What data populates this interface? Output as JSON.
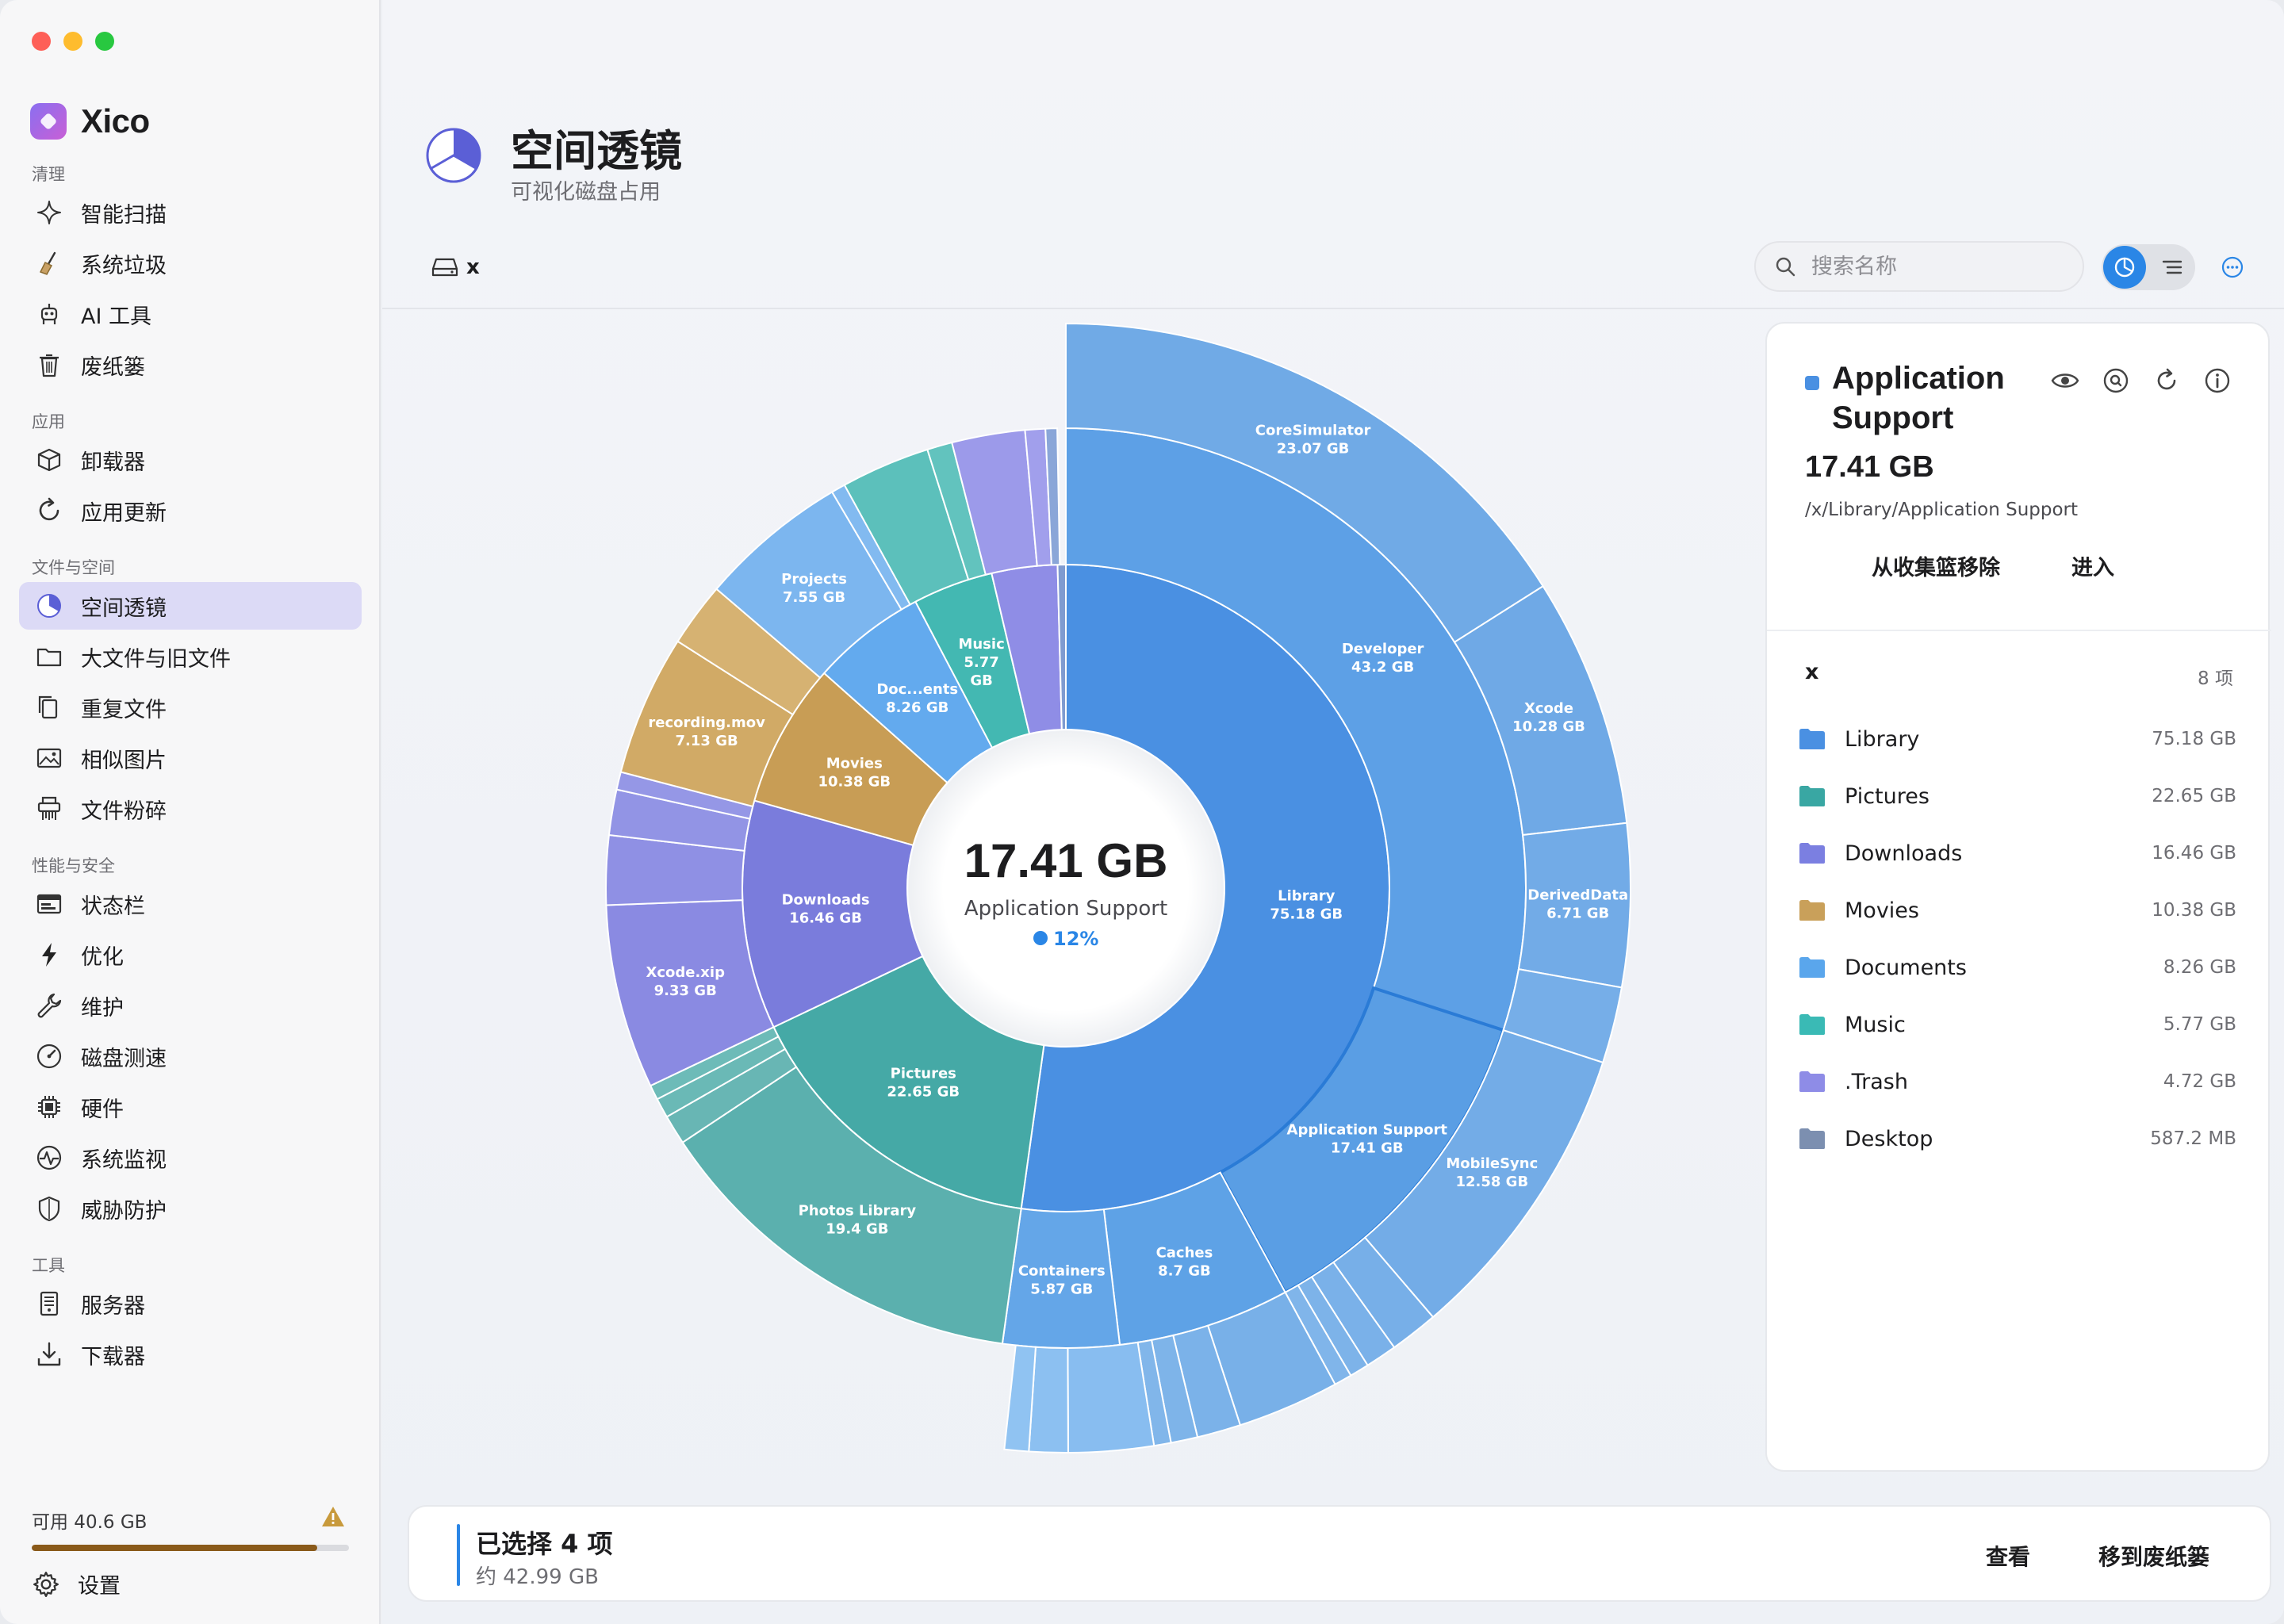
{
  "app": {
    "name": "Xico"
  },
  "sidebar": {
    "sections": [
      {
        "title": "清理",
        "items": [
          {
            "label": "智能扫描",
            "icon": "sparkle-icon"
          },
          {
            "label": "系统垃圾",
            "icon": "broom-icon"
          },
          {
            "label": "AI 工具",
            "icon": "robot-icon"
          },
          {
            "label": "废纸篓",
            "icon": "trash-icon"
          }
        ]
      },
      {
        "title": "应用",
        "items": [
          {
            "label": "卸载器",
            "icon": "box-icon"
          },
          {
            "label": "应用更新",
            "icon": "refresh-icon"
          }
        ]
      },
      {
        "title": "文件与空间",
        "items": [
          {
            "label": "空间透镜",
            "icon": "pie-icon",
            "active": true
          },
          {
            "label": "大文件与旧文件",
            "icon": "folder-icon"
          },
          {
            "label": "重复文件",
            "icon": "duplicate-icon"
          },
          {
            "label": "相似图片",
            "icon": "photo-icon"
          },
          {
            "label": "文件粉碎",
            "icon": "shredder-icon"
          }
        ]
      },
      {
        "title": "性能与安全",
        "items": [
          {
            "label": "状态栏",
            "icon": "menubar-icon"
          },
          {
            "label": "优化",
            "icon": "bolt-icon"
          },
          {
            "label": "维护",
            "icon": "wrench-icon"
          },
          {
            "label": "磁盘测速",
            "icon": "gauge-icon"
          },
          {
            "label": "硬件",
            "icon": "chip-icon"
          },
          {
            "label": "系统监视",
            "icon": "pulse-icon"
          },
          {
            "label": "威胁防护",
            "icon": "shield-icon"
          }
        ]
      },
      {
        "title": "工具",
        "items": [
          {
            "label": "服务器",
            "icon": "server-icon"
          },
          {
            "label": "下载器",
            "icon": "download-icon"
          }
        ]
      }
    ],
    "storage": {
      "label": "可用 40.6 GB",
      "used_fraction": 0.9
    },
    "settings_label": "设置"
  },
  "header": {
    "title": "空间透镜",
    "subtitle": "可视化磁盘占用"
  },
  "toolbar": {
    "drive_name": "x",
    "search_placeholder": "搜索名称"
  },
  "center": {
    "size": "17.41 GB",
    "name": "Application Support",
    "percent": "12%"
  },
  "detail": {
    "title": "Application Support",
    "size": "17.41 GB",
    "path": "/x/Library/Application Support",
    "remove_label": "从收集篮移除",
    "enter_label": "进入",
    "list_title": "x",
    "list_count": "8 项",
    "items": [
      {
        "name": "Library",
        "size": "75.18 GB",
        "color": "#4a90e2"
      },
      {
        "name": "Pictures",
        "size": "22.65 GB",
        "color": "#3aa7a3"
      },
      {
        "name": "Downloads",
        "size": "16.46 GB",
        "color": "#7b7fe0"
      },
      {
        "name": "Movies",
        "size": "10.38 GB",
        "color": "#c9a05a"
      },
      {
        "name": "Documents",
        "size": "8.26 GB",
        "color": "#5aa6ec"
      },
      {
        "name": "Music",
        "size": "5.77 GB",
        "color": "#3bbab5"
      },
      {
        "name": ".Trash",
        "size": "4.72 GB",
        "color": "#8e8ce6"
      },
      {
        "name": "Desktop",
        "size": "587.2 MB",
        "color": "#7c8fb0"
      }
    ]
  },
  "selection": {
    "title": "已选择 4 项",
    "subtitle": "约 42.99 GB",
    "view_label": "查看",
    "trash_label": "移到废纸篓"
  },
  "chart_data": {
    "type": "sunburst",
    "root": "x",
    "selected": "Application Support",
    "rings": [
      [
        {
          "name": "Library",
          "value": 75.18,
          "label": "Library\n75.18 GB",
          "color": "#4a90e2"
        },
        {
          "name": "Pictures",
          "value": 22.65,
          "label": "Pictures\n22.65 GB",
          "color": "#45a9a6"
        },
        {
          "name": "Downloads",
          "value": 16.46,
          "label": "Downloads\n16.46 GB",
          "color": "#7a7cdc"
        },
        {
          "name": "Movies",
          "value": 10.38,
          "label": "Movies\n10.38 GB",
          "color": "#c89d55"
        },
        {
          "name": "Documents",
          "value": 8.26,
          "label": "Doc...ents\n8.26 GB",
          "color": "#63aaee"
        },
        {
          "name": "Music",
          "value": 5.77,
          "label": "Music\n5.77\nGB",
          "color": "#43b8b2"
        },
        {
          "name": ".Trash",
          "value": 4.72,
          "label": "",
          "color": "#8f8de6"
        },
        {
          "name": "Desktop",
          "value": 0.59,
          "label": "",
          "color": "#7f9bd0"
        }
      ],
      [
        {
          "name": "Developer",
          "value": 43.2,
          "label": "Developer\n43.2 GB",
          "color": "#5da0e6"
        },
        {
          "name": "Application Support",
          "value": 17.41,
          "label": "Application Support\n17.41 GB",
          "color": "#5a9ee4",
          "selected": true
        },
        {
          "name": "Caches",
          "value": 8.7,
          "label": "Caches\n8.7 GB",
          "color": "#5ea2e6"
        },
        {
          "name": "Containers",
          "value": 5.87,
          "label": "Containers\n5.87 GB",
          "color": "#64a6e8"
        },
        {
          "name": "Photos Library",
          "value": 19.4,
          "label": "Photos Library\n19.4 GB",
          "color": "#5bb0ae"
        },
        {
          "name": "",
          "value": 1.5,
          "label": "",
          "color": "#68b6b4"
        },
        {
          "name": "",
          "value": 1.0,
          "label": "",
          "color": "#6ab9b6"
        },
        {
          "name": "",
          "value": 0.75,
          "label": "",
          "color": "#6dbbb8"
        },
        {
          "name": "Xcode.xip",
          "value": 9.33,
          "label": "Xcode.xip\n9.33 GB",
          "color": "#8a8ae2"
        },
        {
          "name": "",
          "value": 3.5,
          "label": "",
          "color": "#8f90e4"
        },
        {
          "name": "",
          "value": 2.3,
          "label": "",
          "color": "#9294e5"
        },
        {
          "name": "",
          "value": 0.9,
          "label": "",
          "color": "#9597e6"
        },
        {
          "name": "recording.mov",
          "value": 7.13,
          "label": "recording.mov\n7.13 GB",
          "color": "#d1aa66"
        },
        {
          "name": "",
          "value": 3.25,
          "label": "",
          "color": "#d6b272"
        },
        {
          "name": "Projects",
          "value": 7.55,
          "label": "Projects\n7.55 GB",
          "color": "#7cb6ef"
        },
        {
          "name": "",
          "value": 0.71,
          "label": "",
          "color": "#82baf0"
        },
        {
          "name": "",
          "value": 4.5,
          "label": "",
          "color": "#5cc0bb"
        },
        {
          "name": "",
          "value": 1.27,
          "label": "",
          "color": "#62c3be"
        },
        {
          "name": "",
          "value": 3.7,
          "label": "",
          "color": "#9c9aea"
        },
        {
          "name": "",
          "value": 1.02,
          "label": "",
          "color": "#a19fec"
        },
        {
          "name": "",
          "value": 0.59,
          "label": "",
          "color": "#8aa6d8"
        }
      ],
      [
        {
          "name": "CoreSimulator",
          "value": 23.07,
          "label": "CoreSimulator\n23.07 GB",
          "color": "#70aae6"
        },
        {
          "name": "Xcode",
          "value": 10.28,
          "label": "Xcode\n10.28 GB",
          "color": "#6fa9e6"
        },
        {
          "name": "DerivedData",
          "value": 6.71,
          "label": "DerivedData\n6.71 GB",
          "color": "#72abe7"
        },
        {
          "name": "",
          "value": 3.14,
          "label": "",
          "color": "#76aee8"
        },
        {
          "name": "MobileSync",
          "value": 12.58,
          "label": "MobileSync\n12.58 GB",
          "color": "#73ace7"
        },
        {
          "name": "",
          "value": 2.0,
          "label": "",
          "color": "#77afe8"
        },
        {
          "name": "",
          "value": 1.3,
          "label": "",
          "color": "#7ab1e9"
        },
        {
          "name": "",
          "value": 0.8,
          "label": "",
          "color": "#7db3e9"
        },
        {
          "name": "",
          "value": 0.73,
          "label": "",
          "color": "#80b5ea"
        },
        {
          "name": "",
          "value": 4.2,
          "label": "",
          "color": "#78b0e8"
        },
        {
          "name": "",
          "value": 1.8,
          "label": "",
          "color": "#7bb2e9"
        },
        {
          "name": "",
          "value": 1.1,
          "label": "",
          "color": "#7eb4e9"
        },
        {
          "name": "",
          "value": 0.7,
          "label": "",
          "color": "#81b6ea"
        },
        {
          "name": "",
          "value": 3.5,
          "label": "",
          "color": "#88bdf0"
        },
        {
          "name": "",
          "value": 1.6,
          "label": "",
          "color": "#8cc0f1"
        },
        {
          "name": "",
          "value": 1.0,
          "label": "",
          "color": "#90c3f2"
        }
      ]
    ]
  }
}
